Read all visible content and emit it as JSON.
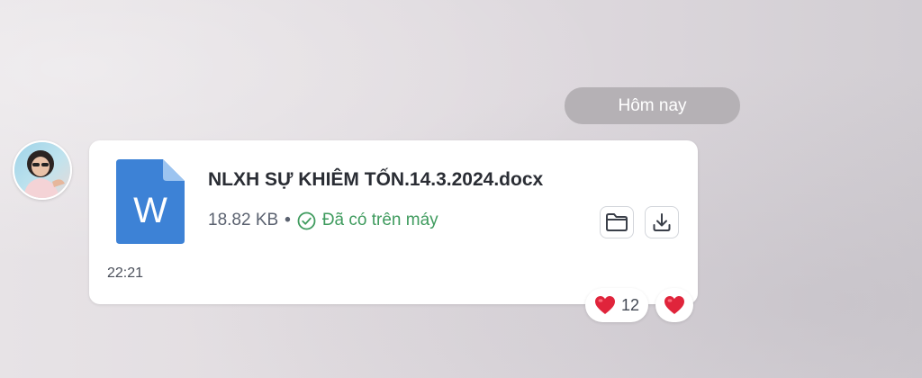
{
  "date_separator": "Hôm nay",
  "message": {
    "sender_avatar": "avatar-photo",
    "file": {
      "icon": "word-document-icon",
      "icon_letter": "W",
      "name": "NLXH SỰ KHIÊM TỐN.14.3.2024.docx",
      "size": "18.82 KB",
      "separator": "•",
      "status_icon": "check-circle-icon",
      "status": "Đã có trên máy"
    },
    "actions": [
      {
        "name": "open-folder",
        "icon": "folder-icon"
      },
      {
        "name": "download",
        "icon": "download-icon"
      }
    ],
    "time": "22:21"
  },
  "reactions": {
    "summary": {
      "icon": "heart-icon",
      "count": "12"
    },
    "quick_react": {
      "icon": "heart-icon"
    }
  },
  "colors": {
    "word_blue": "#3d82d6",
    "word_fold": "#9cc4f0",
    "status_green": "#3f9b5e",
    "heart_red": "#e0243b",
    "date_pill": "#b5b1b5"
  }
}
